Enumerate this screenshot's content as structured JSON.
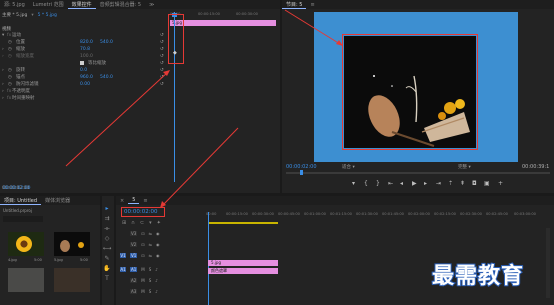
{
  "effect_controls": {
    "tabs": [
      {
        "label": "源: 5.jpg"
      },
      {
        "label": "Lumetri 范围"
      },
      {
        "label": "效果控件"
      },
      {
        "label": "音频剪辑混合器: 5"
      }
    ],
    "more_tabs": "≫",
    "breadcrumb_master": "主要 * 5.jpg",
    "breadcrumb_clip": "5 * 5.jpg",
    "clip_name": "5.jpg",
    "ruler": [
      "00:00",
      "00:00:15:00",
      "00:00:30:00"
    ],
    "section_video": "视频",
    "rows": [
      {
        "label": "运动",
        "value": "",
        "value2": ""
      },
      {
        "label": "位置",
        "value": "820.0",
        "value2": "540.0"
      },
      {
        "label": "缩放",
        "value": "70.8",
        "value2": ""
      },
      {
        "label": "缩放宽度",
        "value": "100.0",
        "value2": ""
      },
      {
        "label": "等比缩放",
        "value": "",
        "value2": ""
      },
      {
        "label": "旋转",
        "value": "0.0",
        "value2": ""
      },
      {
        "label": "锚点",
        "value": "960.0",
        "value2": "540.0"
      },
      {
        "label": "防闪烁滤镜",
        "value": "0.00",
        "value2": ""
      },
      {
        "label": "不透明度",
        "value": "",
        "value2": ""
      },
      {
        "label": "时间重映射",
        "value": "",
        "value2": ""
      }
    ],
    "current_time": "00:00:02:00"
  },
  "program": {
    "title": "节目: 5",
    "timecode": "00:00:02:00",
    "fit": "适合",
    "quality": "完整",
    "duration": "00:00:39:1"
  },
  "project": {
    "tabs": [
      {
        "label": "项目: Untitled"
      },
      {
        "label": "媒体浏览器"
      }
    ],
    "file": "Untitled.prproj",
    "thumbnails": [
      {
        "name": "4.jpg",
        "duration": "5:00"
      },
      {
        "name": "5.jpg",
        "duration": "5:00"
      },
      {
        "name": "",
        "duration": ""
      },
      {
        "name": "",
        "duration": ""
      }
    ]
  },
  "timeline": {
    "tab": "5",
    "timecode": "00:00:02:00",
    "ruler": [
      "00:00",
      "00:00:15:00",
      "00:00:30:00",
      "00:00:45:00",
      "00:01:00:00",
      "00:01:15:00",
      "00:01:30:00",
      "00:01:45:00",
      "00:02:00:00",
      "00:02:15:00",
      "00:02:30:00",
      "00:02:45:00",
      "00:03:00:00"
    ],
    "tracks": [
      {
        "label": "V3"
      },
      {
        "label": "V2"
      },
      {
        "label": "V1"
      },
      {
        "label": "A1"
      },
      {
        "label": "A2"
      },
      {
        "label": "A3"
      }
    ],
    "clips": [
      {
        "name": "5.jpg",
        "color": "#e58fe0"
      },
      {
        "name": "颜色遮罩",
        "color": "#e58fe0"
      }
    ]
  },
  "watermark": "最需教育",
  "colors": {
    "accent": "#3a8ee6",
    "annotation": "#e53935",
    "clip": "#e58fe0",
    "program_bg": "#3d8fd1"
  }
}
